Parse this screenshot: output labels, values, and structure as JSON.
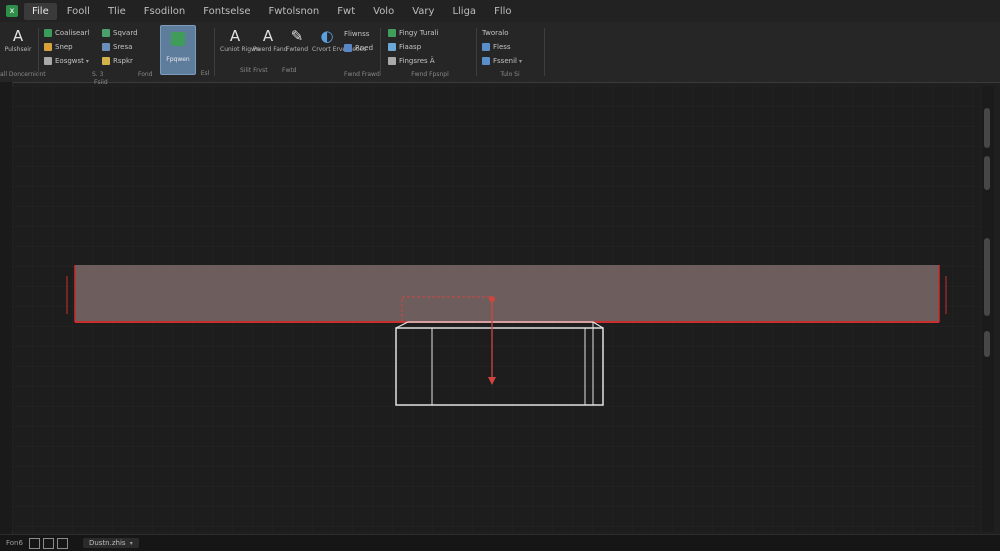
{
  "menu": {
    "app_icon": "spreadsheet-app-icon",
    "tabs": [
      "File",
      "Fooll",
      "Tlie",
      "Fsodilon",
      "Fontselse",
      "Fwtolsnon",
      "Fwt",
      "Volo",
      "Vary",
      "Lliga",
      "Fllo"
    ],
    "active_index": 0
  },
  "ribbon": {
    "g1": {
      "glyph": "A",
      "label": "Pulshseir",
      "group": "all Doncerniont"
    },
    "g2": {
      "rows": [
        "Coalisearl",
        "Snep",
        "Eosgwst"
      ],
      "rows2": [
        "Sqvard",
        "Sresa",
        "Rspkr"
      ],
      "group_left": "S. 3",
      "group_mid": "Fsiid",
      "group_right": "Fond"
    },
    "g3": {
      "label": "Fpqwen",
      "group": "Esl"
    },
    "g4": {
      "btns": [
        {
          "glyph": "A",
          "label": "Cuniot Rigwn"
        },
        {
          "glyph": "A",
          "label": "Pwerd Fand"
        },
        {
          "glyph": "✎",
          "label": "Fwtend"
        },
        {
          "glyph": "◐",
          "label": "Crvort Erverneoes"
        }
      ],
      "rows": [
        "Fliwnss",
        "Rned"
      ],
      "group_a": "Silit Frvst",
      "group_b": "Fwtd",
      "group_c": "Fwnd Frawd"
    },
    "g5": {
      "rows": [
        "Fingy Turali",
        "Fiaasp",
        "Fingsres Ä"
      ],
      "group": "Fwnd Fpsnpl"
    },
    "g6": {
      "title": "Tworalo",
      "rows": [
        "Fless",
        "Fssenil"
      ],
      "group": "Tulo Si"
    }
  },
  "status": {
    "left": "Fon6",
    "sheet": "Dustn.zhis",
    "colors": {
      "accent": "#2f8f4a",
      "selection": "#5e7d9c"
    }
  },
  "drawing": {
    "beam_color": "#6d5d5c",
    "outline_color": "#c8302d",
    "box_color": "#e2e2e2"
  }
}
